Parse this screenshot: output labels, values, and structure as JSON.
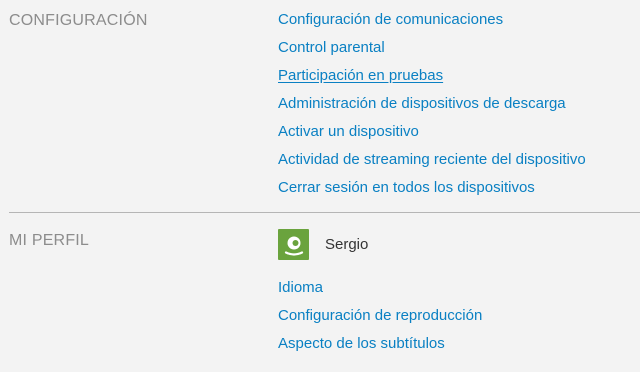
{
  "settings": {
    "title": "CONFIGURACIÓN",
    "links": [
      "Configuración de comunicaciones",
      "Control parental",
      "Participación en pruebas",
      "Administración de dispositivos de descarga",
      "Activar un dispositivo",
      "Actividad de streaming reciente del dispositivo",
      "Cerrar sesión en todos los dispositivos"
    ]
  },
  "profile": {
    "title": "MI PERFIL",
    "name": "Sergio",
    "avatar_icon": "smiley-avatar-icon",
    "avatar_color": "#6aa33d",
    "links": [
      "Idioma",
      "Configuración de reproducción",
      "Aspecto de los subtítulos"
    ]
  },
  "colors": {
    "link": "#0a80c3",
    "section_title": "#8c8c8c",
    "background": "#f3f3f3"
  }
}
